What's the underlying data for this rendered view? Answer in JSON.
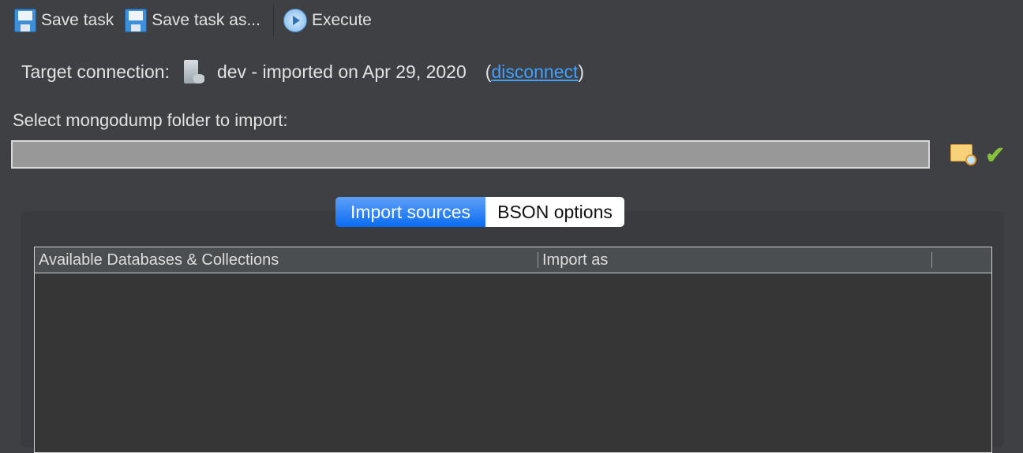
{
  "toolbar": {
    "save": "Save task",
    "save_as": "Save task as...",
    "execute": "Execute"
  },
  "connection": {
    "label": "Target connection:",
    "value": "dev - imported on Apr 29, 2020",
    "open_paren": "(",
    "link": "disconnect",
    "close_paren": ")"
  },
  "folder": {
    "label": "Select mongodump folder to import:",
    "value": ""
  },
  "tabs": [
    {
      "label": "Import sources",
      "active": true
    },
    {
      "label": "BSON options",
      "active": false
    }
  ],
  "table": {
    "columns": [
      "Available Databases & Collections",
      "Import as"
    ],
    "rows": []
  }
}
